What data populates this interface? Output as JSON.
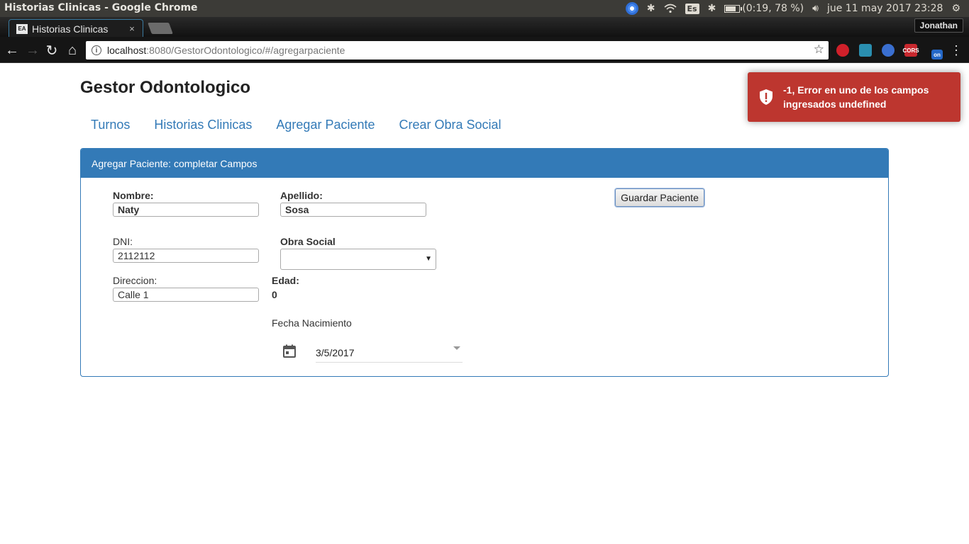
{
  "os": {
    "window_title": "Historias Clinicas - Google Chrome",
    "keyboard": "Es",
    "battery": "(0:19, 78 %)",
    "datetime": "jue 11 may 2017 23:28"
  },
  "browser": {
    "tab_title": "Historias Clinicas",
    "tab_close": "×",
    "profile_name": "Jonathan",
    "url_host": "localhost",
    "url_rest": ":8080/GestorOdontologico/#/agregarpaciente",
    "extensions": [
      {
        "name": "opera-ext-icon",
        "color": "#d0202a",
        "label": ""
      },
      {
        "name": "rotate-ext-icon",
        "color": "#2a8fb0",
        "label": ""
      },
      {
        "name": "globe-ext-icon",
        "color": "#3a6fd0",
        "label": ""
      },
      {
        "name": "cors-ext-icon",
        "color": "#c8282e",
        "label": "CORS"
      },
      {
        "name": "toggle-ext-icon",
        "color": "#2468c8",
        "label": "on"
      }
    ]
  },
  "app": {
    "title": "Gestor Odontologico",
    "nav": [
      "Turnos",
      "Historias Clinicas",
      "Agregar Paciente",
      "Crear Obra Social"
    ]
  },
  "panel": {
    "heading": "Agregar Paciente: completar Campos",
    "nombre_label": "Nombre:",
    "nombre_value": "Naty",
    "apellido_label": "Apellido:",
    "apellido_value": "Sosa",
    "dni_label": "DNI:",
    "dni_value": "2112112",
    "obra_social_label": "Obra Social",
    "obra_social_value": "",
    "direccion_label": "Direccion:",
    "direccion_value": "Calle 1",
    "edad_label": "Edad:",
    "edad_value": "0",
    "fecha_label": "Fecha Nacimiento",
    "fecha_value": "3/5/2017",
    "save_label": "Guardar Paciente"
  },
  "toast": {
    "message": "-1, Error en uno de los campos ingresados undefined",
    "color": "#bd362f"
  },
  "colors": {
    "primary": "#337ab7"
  }
}
